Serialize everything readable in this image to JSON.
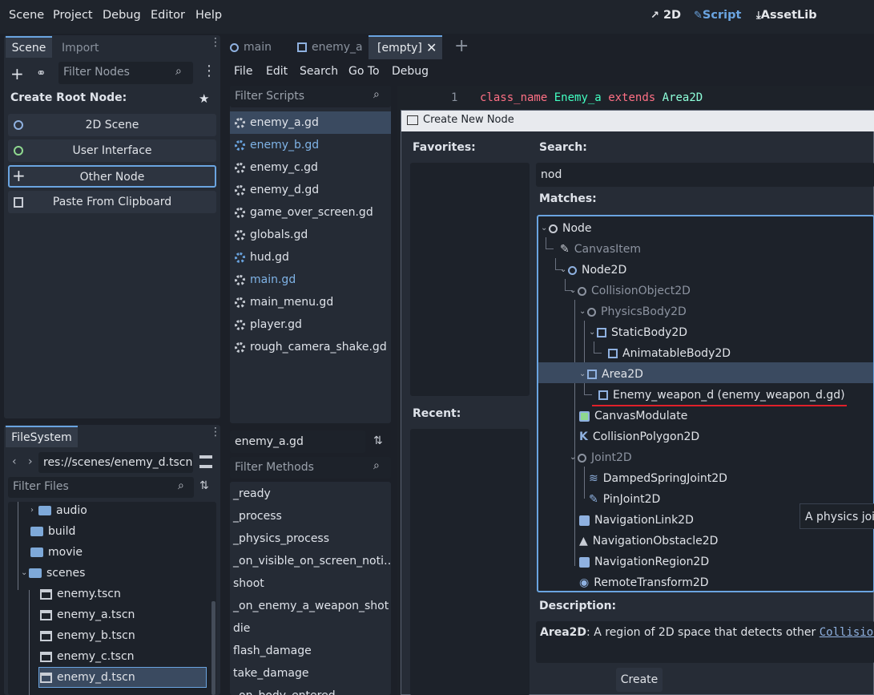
{
  "menubar": {
    "items": [
      "Scene",
      "Project",
      "Debug",
      "Editor",
      "Help"
    ],
    "workspaces": [
      "2D",
      "Script",
      "AssetLib"
    ],
    "ws_icons": [
      "2d-move-icon",
      "script-icon",
      "download-icon"
    ]
  },
  "scene_dock": {
    "tabs": [
      "Scene",
      "Import"
    ],
    "filter_placeholder": "Filter Nodes",
    "create_root_label": "Create Root Node:",
    "buttons": [
      "2D Scene",
      "User Interface",
      "Other Node",
      "Paste From Clipboard"
    ]
  },
  "filesystem": {
    "tab": "FileSystem",
    "path": "res://scenes/enemy_d.tscn",
    "filter_placeholder": "Filter Files",
    "tree": [
      {
        "label": "audio",
        "kind": "folder"
      },
      {
        "label": "build",
        "kind": "folder"
      },
      {
        "label": "movie",
        "kind": "folder"
      },
      {
        "label": "scenes",
        "kind": "folder"
      },
      {
        "label": "enemy.tscn",
        "kind": "scene"
      },
      {
        "label": "enemy_a.tscn",
        "kind": "scene"
      },
      {
        "label": "enemy_b.tscn",
        "kind": "scene"
      },
      {
        "label": "enemy_c.tscn",
        "kind": "scene"
      },
      {
        "label": "enemy_d.tscn",
        "kind": "scene"
      }
    ]
  },
  "editor_tabs": [
    {
      "label": "main"
    },
    {
      "label": "enemy_a"
    },
    {
      "label": "[empty]"
    }
  ],
  "script_menu": [
    "File",
    "Edit",
    "Search",
    "Go To",
    "Debug"
  ],
  "scripts": {
    "filter_placeholder": "Filter Scripts",
    "items": [
      "enemy_a.gd",
      "enemy_b.gd",
      "enemy_c.gd",
      "enemy_d.gd",
      "game_over_screen.gd",
      "globals.gd",
      "hud.gd",
      "main.gd",
      "main_menu.gd",
      "player.gd",
      "rough_camera_shake.gd"
    ],
    "current": "enemy_a.gd"
  },
  "methods": {
    "filter_placeholder": "Filter Methods",
    "items": [
      "_ready",
      "_process",
      "_physics_process",
      "_on_visible_on_screen_noti…",
      "shoot",
      "_on_enemy_a_weapon_shot",
      "die",
      "flash_damage",
      "take_damage",
      "_on_body_entered"
    ]
  },
  "code": {
    "line_number": "1",
    "kw1": "class_name",
    "name": "Enemy_a",
    "kw2": "extends",
    "base": "Area2D"
  },
  "dialog": {
    "title": "Create New Node",
    "favorites": "Favorites:",
    "recent": "Recent:",
    "search_label": "Search:",
    "search_value": "nod",
    "matches_label": "Matches:",
    "description_label": "Description:",
    "description_name": "Area2D",
    "description_text": ": A region of 2D space that detects other ",
    "description_link": "CollisionOb",
    "tooltip": "A physics join",
    "create_button": "Create",
    "tree": [
      "Node",
      "CanvasItem",
      "Node2D",
      "CollisionObject2D",
      "PhysicsBody2D",
      "StaticBody2D",
      "AnimatableBody2D",
      "Area2D",
      "Enemy_weapon_d (enemy_weapon_d.gd)",
      "CanvasModulate",
      "CollisionPolygon2D",
      "Joint2D",
      "DampedSpringJoint2D",
      "PinJoint2D",
      "NavigationLink2D",
      "NavigationObstacle2D",
      "NavigationRegion2D",
      "RemoteTransform2D"
    ]
  },
  "colors": {
    "accent": "#6aa4e0",
    "underline": "#e0202a",
    "selection": "#3a4a60"
  }
}
